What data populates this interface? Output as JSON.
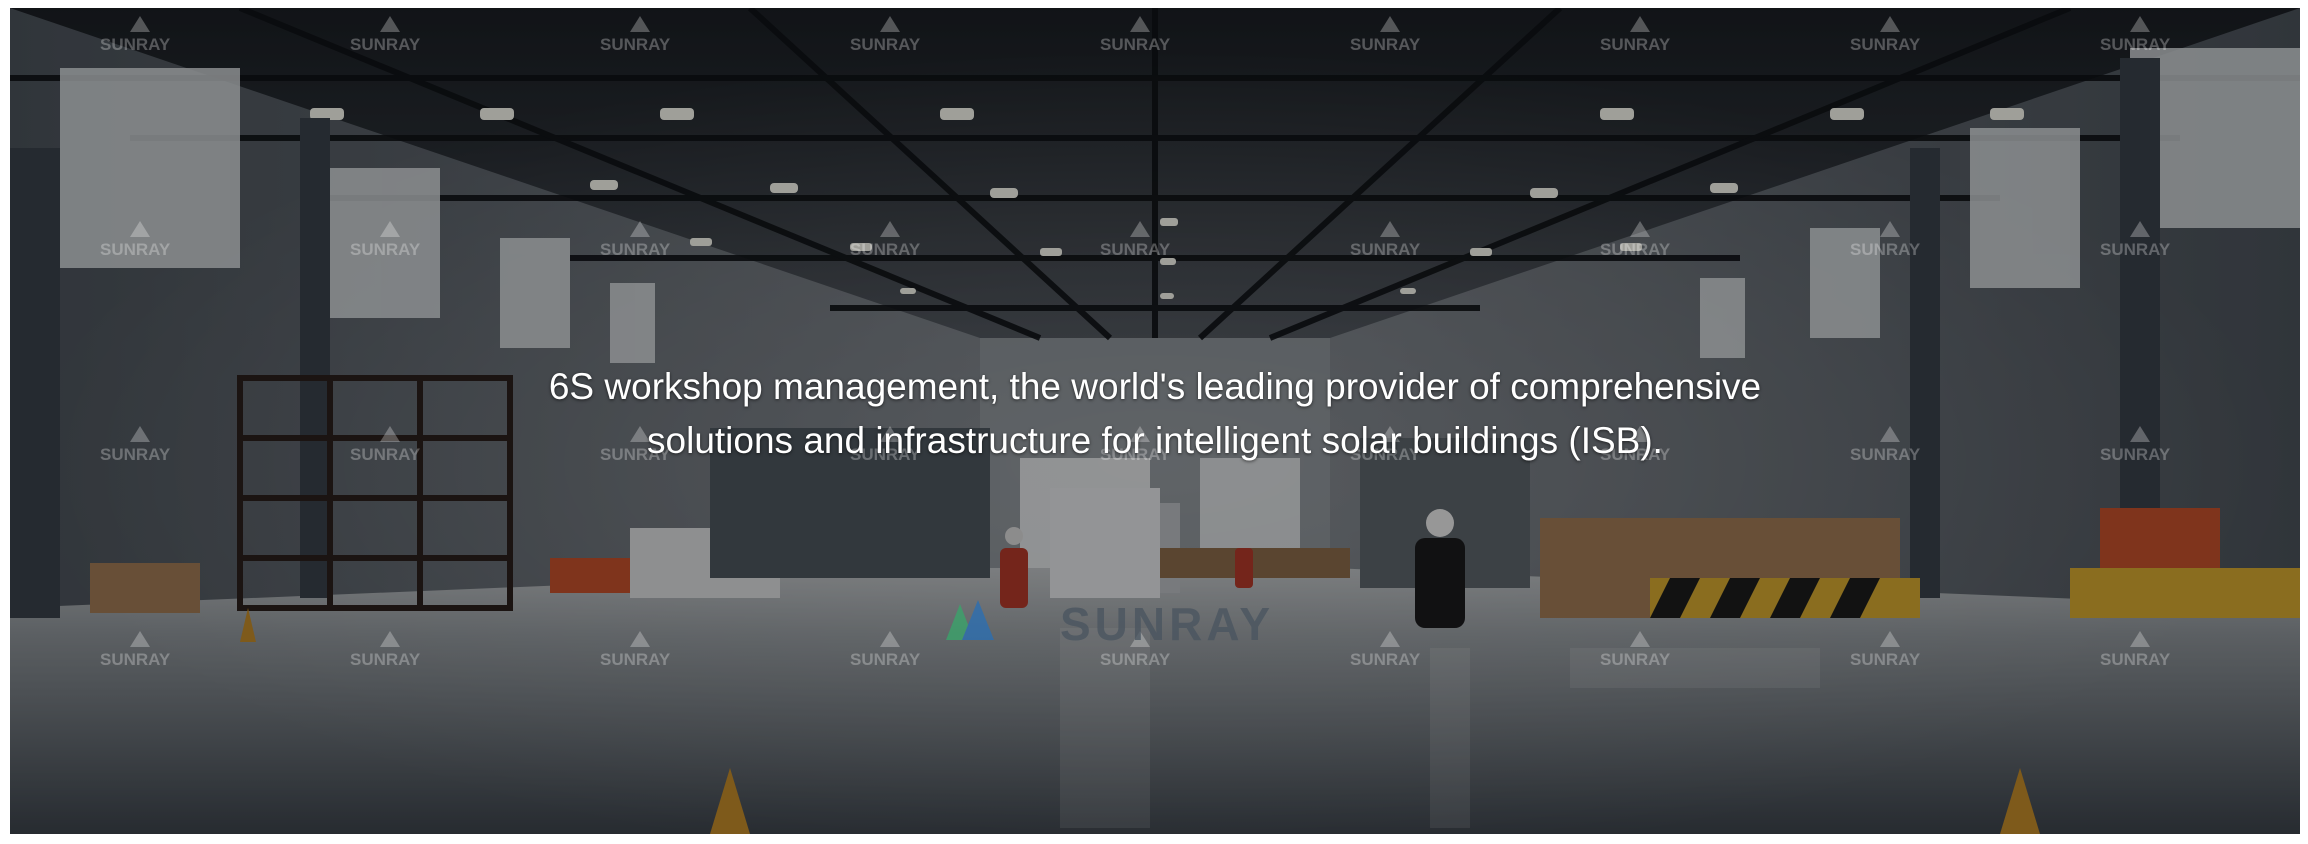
{
  "banner": {
    "caption_line_1": "6S workshop management, the world's leading provider of comprehensive",
    "caption_line_2": "solutions and infrastructure for intelligent solar buildings (ISB).",
    "watermark_text": "SUNRAY",
    "center_logo_text": "SUNRAY",
    "colors": {
      "ceiling": "#23272d",
      "wall": "#5c636b",
      "floor": "#9aa0a6",
      "ceiling_light": "#f4f4ec",
      "rack_orange": "#c4502b",
      "cardboard": "#a07a55",
      "hazard_yellow": "#d4a830",
      "logo_blue": "#2b6fb3",
      "logo_green": "#3aa56b"
    }
  }
}
